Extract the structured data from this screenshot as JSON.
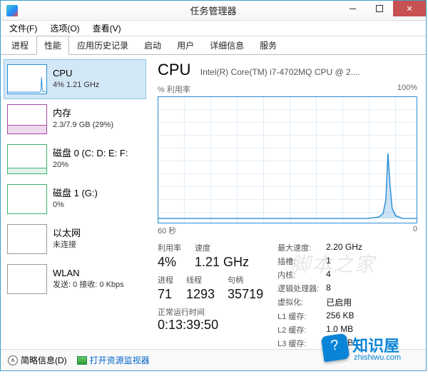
{
  "window": {
    "title": "任务管理器"
  },
  "menu": {
    "file": "文件(F)",
    "options": "选项(O)",
    "view": "查看(V)"
  },
  "tabs": [
    "进程",
    "性能",
    "应用历史记录",
    "启动",
    "用户",
    "详细信息",
    "服务"
  ],
  "sidebar": {
    "items": [
      {
        "name": "CPU",
        "stat": "4% 1.21 GHz"
      },
      {
        "name": "内存",
        "stat": "2.3/7.9 GB (29%)"
      },
      {
        "name": "磁盘 0 (C: D: E: F:",
        "stat": "20%"
      },
      {
        "name": "磁盘 1 (G:)",
        "stat": "0%"
      },
      {
        "name": "以太网",
        "stat": "未连接"
      },
      {
        "name": "WLAN",
        "stat": "发送: 0 接收: 0 Kbps"
      }
    ]
  },
  "main": {
    "title": "CPU",
    "subtitle": "Intel(R) Core(TM) i7-4702MQ CPU @ 2....",
    "util_label": "% 利用率",
    "scale_top": "100%",
    "x_left": "60 秒",
    "x_right": "0",
    "stats1": {
      "util_lbl": "利用率",
      "util_val": "4%",
      "speed_lbl": "速度",
      "speed_val": "1.21 GHz",
      "proc_lbl": "进程",
      "proc_val": "71",
      "threads_lbl": "线程",
      "threads_val": "1293",
      "handles_lbl": "句柄",
      "handles_val": "35719",
      "uptime_lbl": "正常运行时间",
      "uptime_val": "0:13:39:50"
    },
    "stats2": {
      "maxspeed_lbl": "最大速度:",
      "maxspeed_val": "2.20 GHz",
      "sockets_lbl": "插槽:",
      "sockets_val": "1",
      "cores_lbl": "内核:",
      "cores_val": "4",
      "logical_lbl": "逻辑处理器:",
      "logical_val": "8",
      "virt_lbl": "虚拟化:",
      "virt_val": "已启用",
      "l1_lbl": "L1 缓存:",
      "l1_val": "256 KB",
      "l2_lbl": "L2 缓存:",
      "l2_val": "1.0 MB",
      "l3_lbl": "L3 缓存:",
      "l3_val": "6.0 MB"
    }
  },
  "statusbar": {
    "less": "简略信息(D)",
    "resmon": "打开资源监视器"
  },
  "badge": {
    "text": "知识屋",
    "url": "zhishiwu.com"
  },
  "chart_data": {
    "type": "line",
    "title": "% 利用率",
    "xlabel": "秒",
    "ylabel": "利用率 %",
    "xlim": [
      60,
      0
    ],
    "ylim": [
      0,
      100
    ],
    "series": [
      {
        "name": "CPU 利用率",
        "x": [
          60,
          55,
          50,
          45,
          40,
          35,
          30,
          25,
          20,
          15,
          10,
          8,
          7,
          6,
          5,
          4.5,
          4,
          3,
          2,
          1,
          0
        ],
        "values": [
          3,
          3,
          4,
          3,
          4,
          3,
          4,
          3,
          4,
          3,
          4,
          8,
          20,
          55,
          30,
          12,
          6,
          5,
          4,
          4,
          4
        ]
      }
    ]
  }
}
